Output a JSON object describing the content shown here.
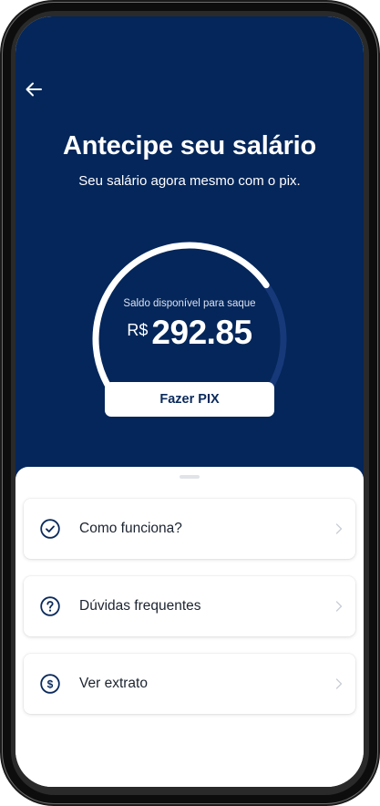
{
  "header": {
    "title": "Antecipe seu salário",
    "subtitle": "Seu salário agora mesmo com o pix."
  },
  "balance": {
    "caption": "Saldo disponível para saque",
    "currency": "R$",
    "amount": "292.85",
    "gauge_fill_fraction": 0.7
  },
  "primary_action": {
    "label": "Fazer PIX"
  },
  "menu": {
    "items": [
      {
        "label": "Como funciona?",
        "icon": "check-circle-icon"
      },
      {
        "label": "Dúvidas frequentes",
        "icon": "question-circle-icon"
      },
      {
        "label": "Ver extrato",
        "icon": "dollar-circle-icon"
      }
    ]
  },
  "colors": {
    "hero_background": "#04265a",
    "accent": "#0a2a5c",
    "gauge_track": "#17397a",
    "gauge_fill": "#ffffff"
  }
}
